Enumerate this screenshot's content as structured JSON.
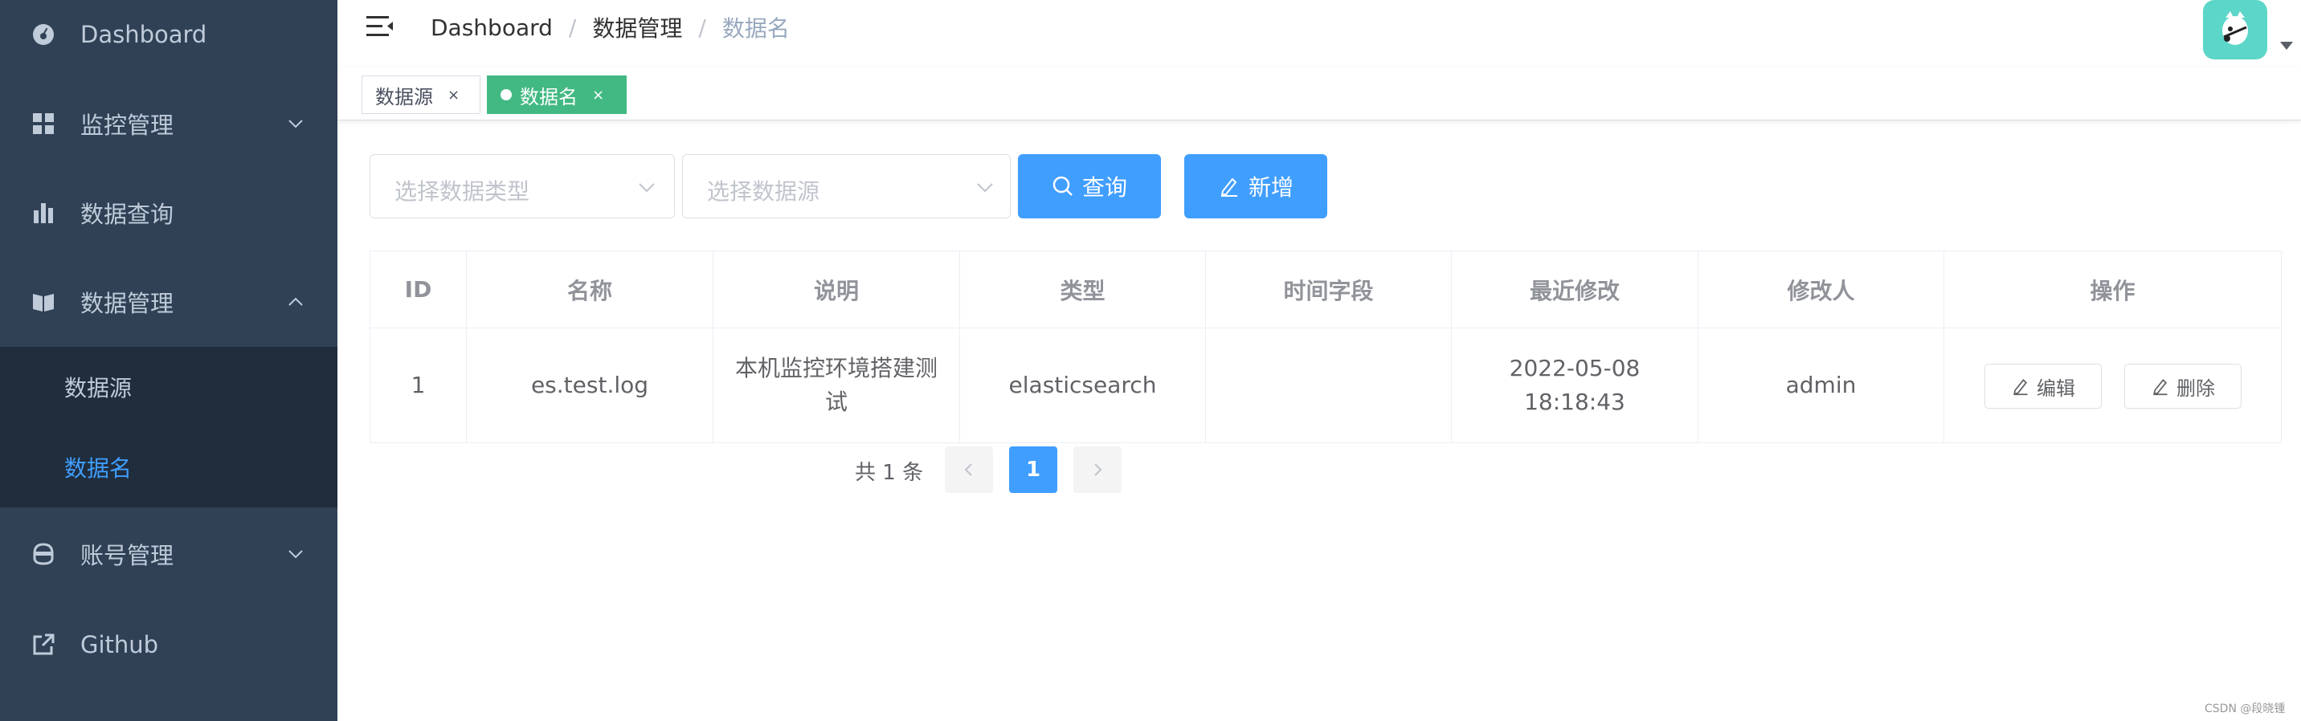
{
  "sidebar": {
    "items": [
      {
        "label": "Dashboard",
        "icon": "dashboard-icon"
      },
      {
        "label": "监控管理",
        "icon": "grid-icon"
      },
      {
        "label": "数据查询",
        "icon": "bar-chart-icon"
      },
      {
        "label": "数据管理",
        "icon": "book-icon"
      },
      {
        "label": "账号管理",
        "icon": "user-icon"
      },
      {
        "label": "Github",
        "icon": "external-link-icon"
      }
    ],
    "sub_items": [
      {
        "label": "数据源"
      },
      {
        "label": "数据名"
      }
    ],
    "active_color": "#409eff"
  },
  "navbar": {
    "breadcrumb": [
      "Dashboard",
      "数据管理",
      "数据名"
    ]
  },
  "tags": [
    {
      "label": "数据源",
      "close": "×"
    },
    {
      "label": "数据名",
      "close": "×"
    }
  ],
  "filters": {
    "type_placeholder": "选择数据类型",
    "source_placeholder": "选择数据源",
    "query_label": "查询",
    "add_label": "新增"
  },
  "table": {
    "headers": [
      "ID",
      "名称",
      "说明",
      "类型",
      "时间字段",
      "最近修改",
      "修改人",
      "操作"
    ],
    "rows": [
      {
        "id": "1",
        "name": "es.test.log",
        "desc": "本机监控环境搭建测试",
        "type": "elasticsearch",
        "time_field": "",
        "modified": "2022-05-08 18:18:43",
        "modifier": "admin",
        "edit_label": "编辑",
        "delete_label": "删除"
      }
    ]
  },
  "pagination": {
    "total_text": "共 1 条",
    "current_page": "1"
  },
  "watermark": "CSDN @段晓锺",
  "colors": {
    "sidebar_bg": "#304156",
    "submenu_bg": "#1f2d3d",
    "primary": "#409eff",
    "tag_active": "#42b983"
  }
}
